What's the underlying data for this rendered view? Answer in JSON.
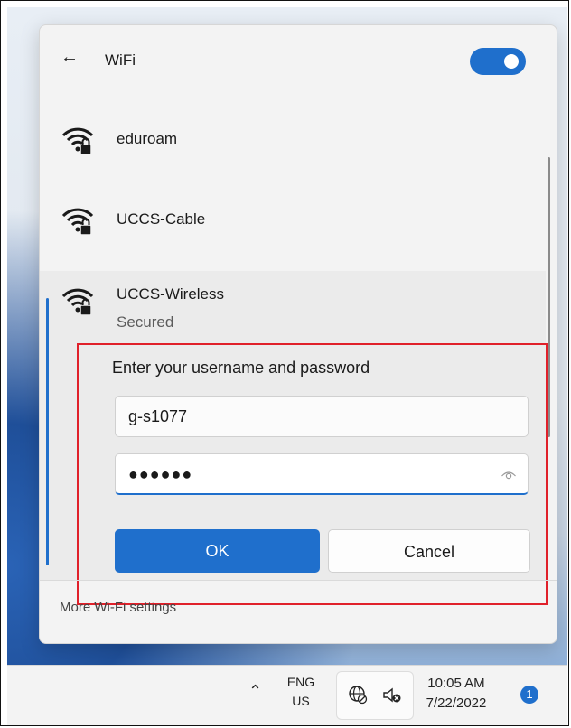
{
  "header": {
    "back_icon": "arrow-left-icon",
    "title": "WiFi",
    "toggle_on": true,
    "accent": "#1f6fcc"
  },
  "networks": [
    {
      "name": "eduroam",
      "icon": "wifi-locked-icon"
    },
    {
      "name": "UCCS-Cable",
      "icon": "wifi-locked-icon"
    },
    {
      "name": "UCCS-Wireless",
      "status": "Secured",
      "icon": "wifi-locked-icon"
    }
  ],
  "login": {
    "prompt": "Enter your username and password",
    "username": "g-s1077",
    "password_mask": "●●●●●●",
    "ok_label": "OK",
    "cancel_label": "Cancel",
    "highlight_color": "#e0202a"
  },
  "footer": {
    "link": "More Wi-Fi settings"
  },
  "taskbar": {
    "lang": "ENG",
    "region": "US",
    "time": "10:05 AM",
    "date": "7/22/2022",
    "notifications": "1"
  }
}
